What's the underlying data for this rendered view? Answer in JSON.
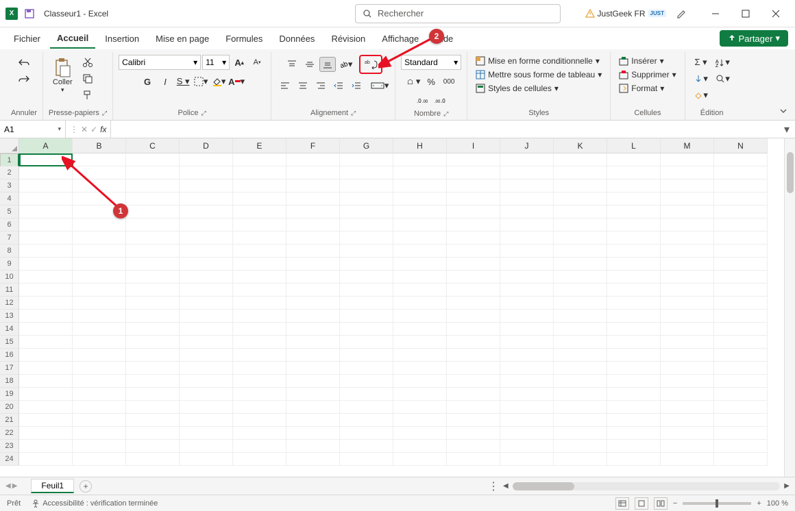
{
  "titlebar": {
    "app_title": "Classeur1  -  Excel",
    "search_placeholder": "Rechercher",
    "user_name": "JustGeek FR",
    "user_badge": "JUST"
  },
  "tabs": {
    "fichier": "Fichier",
    "accueil": "Accueil",
    "insertion": "Insertion",
    "mise_en_page": "Mise en page",
    "formules": "Formules",
    "donnees": "Données",
    "revision": "Révision",
    "affichage": "Affichage",
    "aide": "Aide",
    "partager": "Partager"
  },
  "ribbon": {
    "annuler": "Annuler",
    "coller": "Coller",
    "presse_papiers": "Presse-papiers",
    "font_name": "Calibri",
    "font_size": "11",
    "police": "Police",
    "alignement": "Alignement",
    "number_format": "Standard",
    "nombre": "Nombre",
    "percent": "%",
    "thousands": "000",
    "cond_format": "Mise en forme conditionnelle",
    "format_table": "Mettre sous forme de tableau",
    "cell_styles": "Styles de cellules",
    "styles": "Styles",
    "inserer": "Insérer",
    "supprimer": "Supprimer",
    "format": "Format",
    "cellules": "Cellules",
    "edition": "Édition"
  },
  "formula": {
    "cell_ref": "A1",
    "fx": "fx"
  },
  "grid": {
    "columns": [
      "A",
      "B",
      "C",
      "D",
      "E",
      "F",
      "G",
      "H",
      "I",
      "J",
      "K",
      "L",
      "M",
      "N"
    ],
    "rows": [
      "1",
      "2",
      "3",
      "4",
      "5",
      "6",
      "7",
      "8",
      "9",
      "10",
      "11",
      "12",
      "13",
      "14",
      "15",
      "16",
      "17",
      "18",
      "19",
      "20",
      "21",
      "22",
      "23",
      "24"
    ]
  },
  "annotations": {
    "one": "1",
    "two": "2"
  },
  "sheets": {
    "sheet1": "Feuil1"
  },
  "status": {
    "ready": "Prêt",
    "accessibility": "Accessibilité : vérification terminée",
    "zoom": "100 %"
  }
}
